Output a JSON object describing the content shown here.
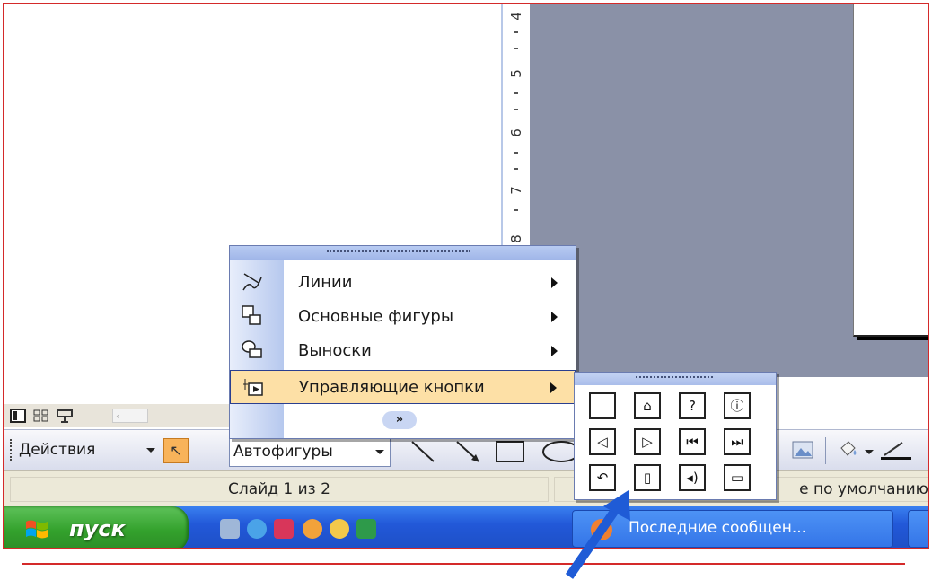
{
  "ruler": {
    "labels": [
      "4",
      "5",
      "6",
      "7",
      "8"
    ]
  },
  "view_toolbar": {
    "buttons": [
      "normal-view-icon",
      "slide-sorter-icon",
      "slideshow-icon"
    ]
  },
  "draw_toolbar": {
    "actions_label": "Действия",
    "autoshapes_label": "Автофигуры",
    "tools": [
      "select-arrow-icon",
      "line-icon",
      "arrow-icon",
      "rectangle-icon",
      "oval-icon",
      "picture-icon",
      "fill-color-icon"
    ]
  },
  "autoshapes_menu": {
    "items": [
      {
        "label": "Линии",
        "icon": "lines-icon"
      },
      {
        "label": "Основные фигуры",
        "icon": "basic-shapes-icon"
      },
      {
        "label": "Выноски",
        "icon": "callouts-icon"
      },
      {
        "label": "Управляющие кнопки",
        "icon": "action-buttons-icon",
        "highlighted": true
      }
    ],
    "expand_label": "»"
  },
  "action_buttons_submenu": {
    "buttons": [
      {
        "name": "custom",
        "glyph": ""
      },
      {
        "name": "home",
        "glyph": "⌂"
      },
      {
        "name": "help",
        "glyph": "?"
      },
      {
        "name": "information",
        "glyph": "ⓘ"
      },
      {
        "name": "back-previous",
        "glyph": "◁"
      },
      {
        "name": "forward-next",
        "glyph": "▷"
      },
      {
        "name": "beginning",
        "glyph": "⏮"
      },
      {
        "name": "end",
        "glyph": "⏭"
      },
      {
        "name": "return",
        "glyph": "↶"
      },
      {
        "name": "document",
        "glyph": "▯"
      },
      {
        "name": "sound",
        "glyph": "◂)"
      },
      {
        "name": "movie",
        "glyph": "▭"
      }
    ]
  },
  "statusbar": {
    "slide_counter": "Слайд 1 из 2",
    "design_template": "е по умолчанию"
  },
  "taskbar": {
    "start_label": "пуск",
    "quick_launch": [
      "ie-icon",
      "firefox-like-icon",
      "save-icon",
      "media-icon",
      "player-icon",
      "app-icon"
    ],
    "task_label": "Последние сообщен..."
  },
  "colors": {
    "frame_border": "#d42a2a",
    "canvas": "#8a91a7",
    "menu_highlight": "#fde0a6",
    "taskbar_blue": "#2258d8",
    "start_green": "#33a12c",
    "pointer_arrow": "#1f5bd6"
  }
}
